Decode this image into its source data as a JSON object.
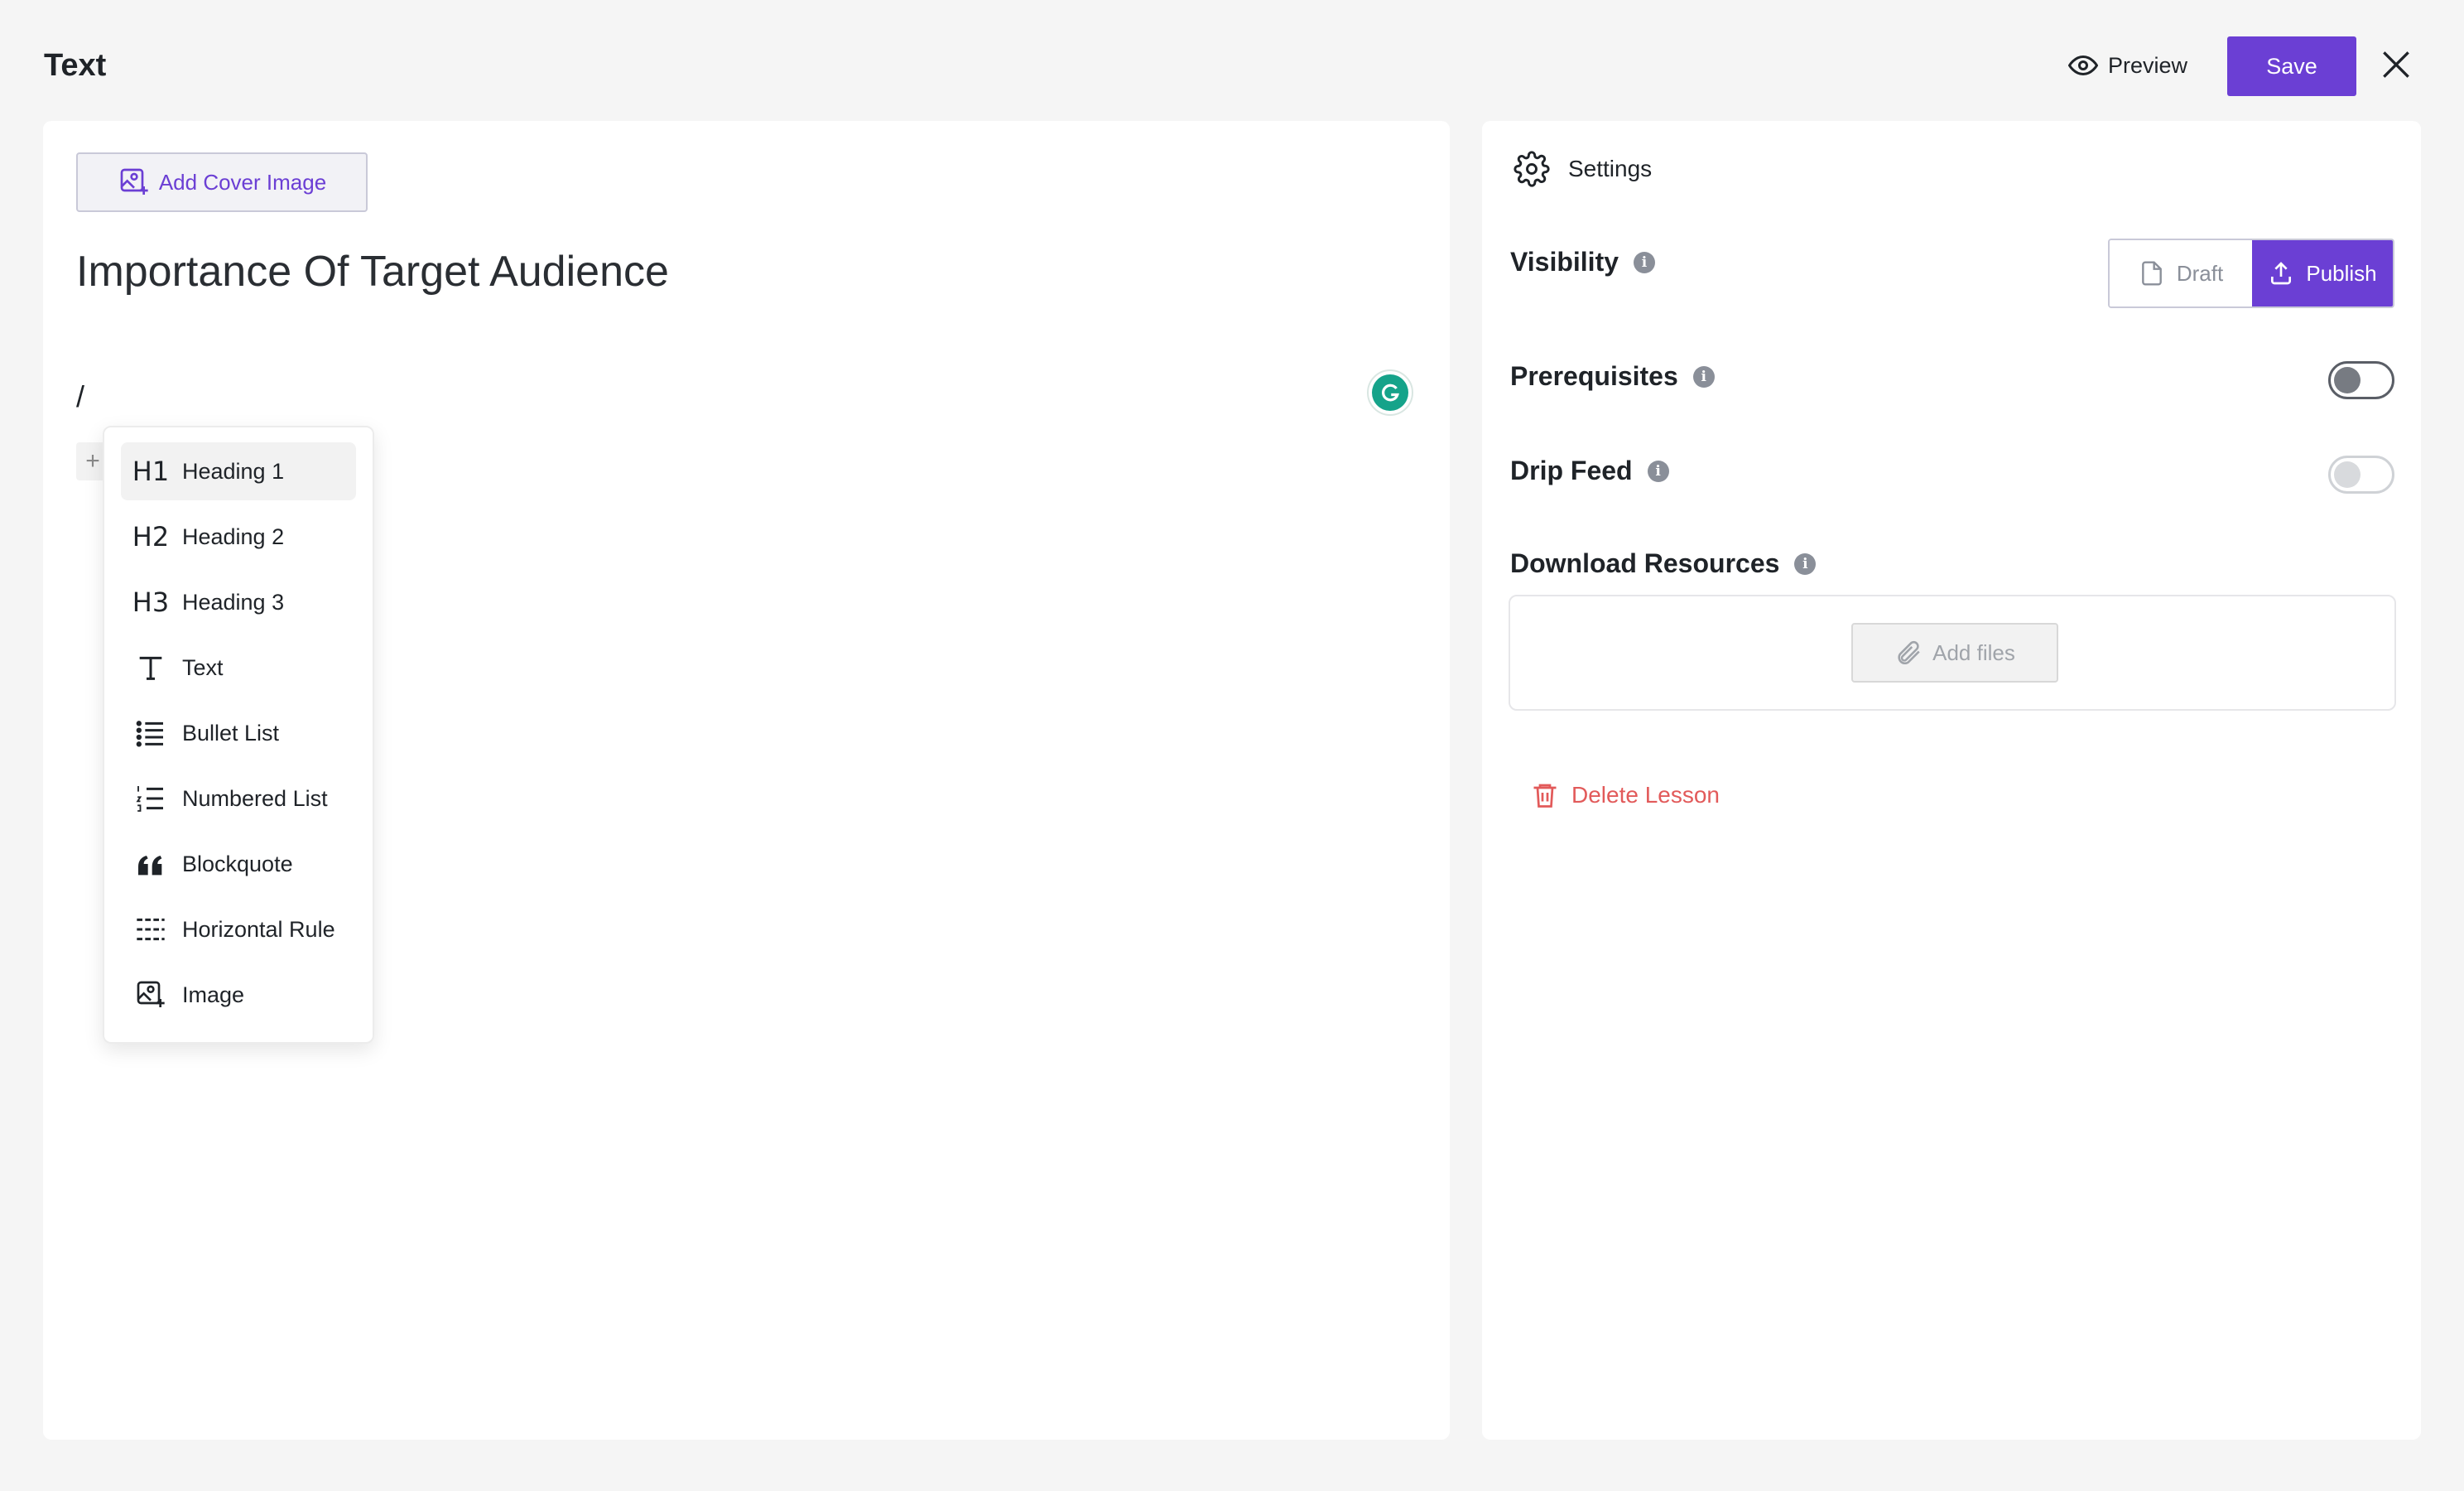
{
  "header": {
    "title": "Text",
    "preview_label": "Preview",
    "save_label": "Save"
  },
  "editor": {
    "cover_button_label": "Add Cover Image",
    "lesson_title": "Importance Of Target Audience",
    "current_input": "/",
    "plus_symbol": "+",
    "menu": [
      {
        "label": "Heading 1",
        "icon": "heading-1-icon",
        "glyph": "H1",
        "active": true
      },
      {
        "label": "Heading 2",
        "icon": "heading-2-icon",
        "glyph": "H2",
        "active": false
      },
      {
        "label": "Heading 3",
        "icon": "heading-3-icon",
        "glyph": "H3",
        "active": false
      },
      {
        "label": "Text",
        "icon": "text-icon",
        "active": false
      },
      {
        "label": "Bullet List",
        "icon": "bullet-list-icon",
        "active": false
      },
      {
        "label": "Numbered List",
        "icon": "numbered-list-icon",
        "active": false
      },
      {
        "label": "Blockquote",
        "icon": "blockquote-icon",
        "active": false
      },
      {
        "label": "Horizontal Rule",
        "icon": "horizontal-rule-icon",
        "active": false
      },
      {
        "label": "Image",
        "icon": "image-icon",
        "active": false
      }
    ]
  },
  "settings": {
    "heading": "Settings",
    "visibility": {
      "label": "Visibility",
      "draft_label": "Draft",
      "publish_label": "Publish",
      "selected": "Publish"
    },
    "prerequisites": {
      "label": "Prerequisites",
      "enabled": true
    },
    "drip_feed": {
      "label": "Drip Feed",
      "enabled": false
    },
    "download_resources": {
      "label": "Download Resources",
      "add_files_label": "Add files"
    },
    "delete_label": "Delete Lesson",
    "info_glyph": "i"
  },
  "colors": {
    "accent": "#6b3fd4",
    "danger": "#e25a5a",
    "background": "#f5f5f5",
    "grammarly": "#15a38a"
  }
}
